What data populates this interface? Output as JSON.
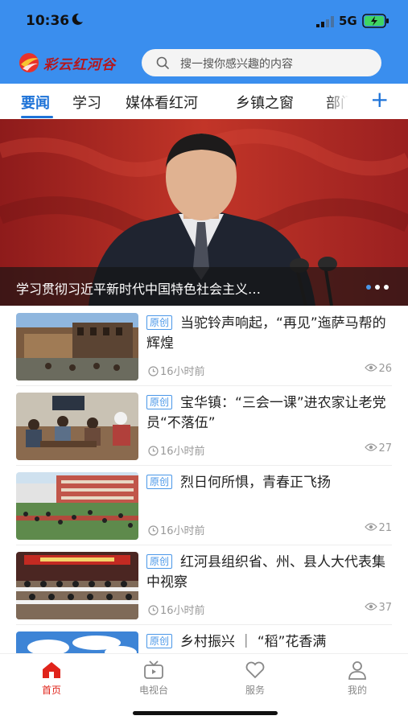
{
  "status_bar": {
    "time": "10:36",
    "network": "5G"
  },
  "header": {
    "logo_text": "彩云红河谷",
    "search": {
      "placeholder": "搜一搜你感兴趣的内容"
    }
  },
  "tabs": [
    {
      "label": "要闻",
      "active": true
    },
    {
      "label": "学习"
    },
    {
      "label": "媒体看红河"
    },
    {
      "label": "乡镇之窗"
    },
    {
      "label": "部门"
    }
  ],
  "banner": {
    "caption": "学习贯彻习近平新时代中国特色社会主义…",
    "dot_count": 3,
    "active_dot": 1
  },
  "news": [
    {
      "tag": "原创",
      "title": "当驼铃声响起，“再见”迤萨马帮的辉煌",
      "time": "16小时前",
      "views": "26"
    },
    {
      "tag": "原创",
      "title": "宝华镇：“三会一课”进农家让老党员“不落伍”",
      "time": "16小时前",
      "views": "27"
    },
    {
      "tag": "原创",
      "title": "烈日何所惧，青春正飞扬",
      "time": "16小时前",
      "views": "21"
    },
    {
      "tag": "原创",
      "title": "红河县组织省、州、县人大代表集中视察",
      "time": "16小时前",
      "views": "37"
    },
    {
      "tag": "原创",
      "title": "乡村振兴 ｜ “稻”花香满",
      "time": "",
      "views": ""
    }
  ],
  "bottom_nav": [
    {
      "label": "首页",
      "icon": "home-icon",
      "active": true
    },
    {
      "label": "电视台",
      "icon": "tv-icon"
    },
    {
      "label": "服务",
      "icon": "heart-icon"
    },
    {
      "label": "我的",
      "icon": "user-icon"
    }
  ],
  "colors": {
    "header_blue": "#3a8eee",
    "accent_blue": "#1e73d8",
    "active_red": "#e0241b"
  }
}
